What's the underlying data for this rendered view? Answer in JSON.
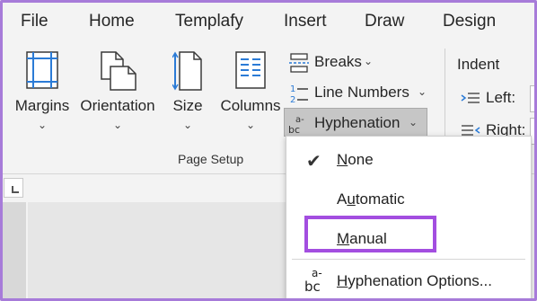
{
  "tabs": {
    "file": "File",
    "home": "Home",
    "templafy": "Templafy",
    "insert": "Insert",
    "draw": "Draw",
    "design": "Design"
  },
  "page_setup": {
    "margins": "Margins",
    "orientation": "Orientation",
    "size": "Size",
    "columns": "Columns",
    "breaks": "Breaks",
    "line_numbers": "Line Numbers",
    "hyphenation": "Hyphenation",
    "group_label": "Page Setup"
  },
  "indent": {
    "title": "Indent",
    "left": "Left:",
    "right": "Right:"
  },
  "hyphenation_menu": {
    "items": [
      {
        "label_first": "N",
        "label_rest": "one",
        "checked": true
      },
      {
        "label_first": "A",
        "label_u": "u",
        "label_rest": "tomatic",
        "checked": false
      },
      {
        "label_first": "M",
        "label_rest": "anual",
        "checked": false,
        "highlighted": true
      },
      {
        "label_first": "H",
        "label_rest": "yphenation Options...",
        "checked": false
      }
    ]
  },
  "icons": {
    "chevron": "chevron-down-icon",
    "check": "checkmark-icon",
    "hyphenation": "hyphenation-icon"
  },
  "colors": {
    "highlight": "#a34ee0",
    "frame": "#a77bd9",
    "active_button": "#c6c6c6"
  }
}
